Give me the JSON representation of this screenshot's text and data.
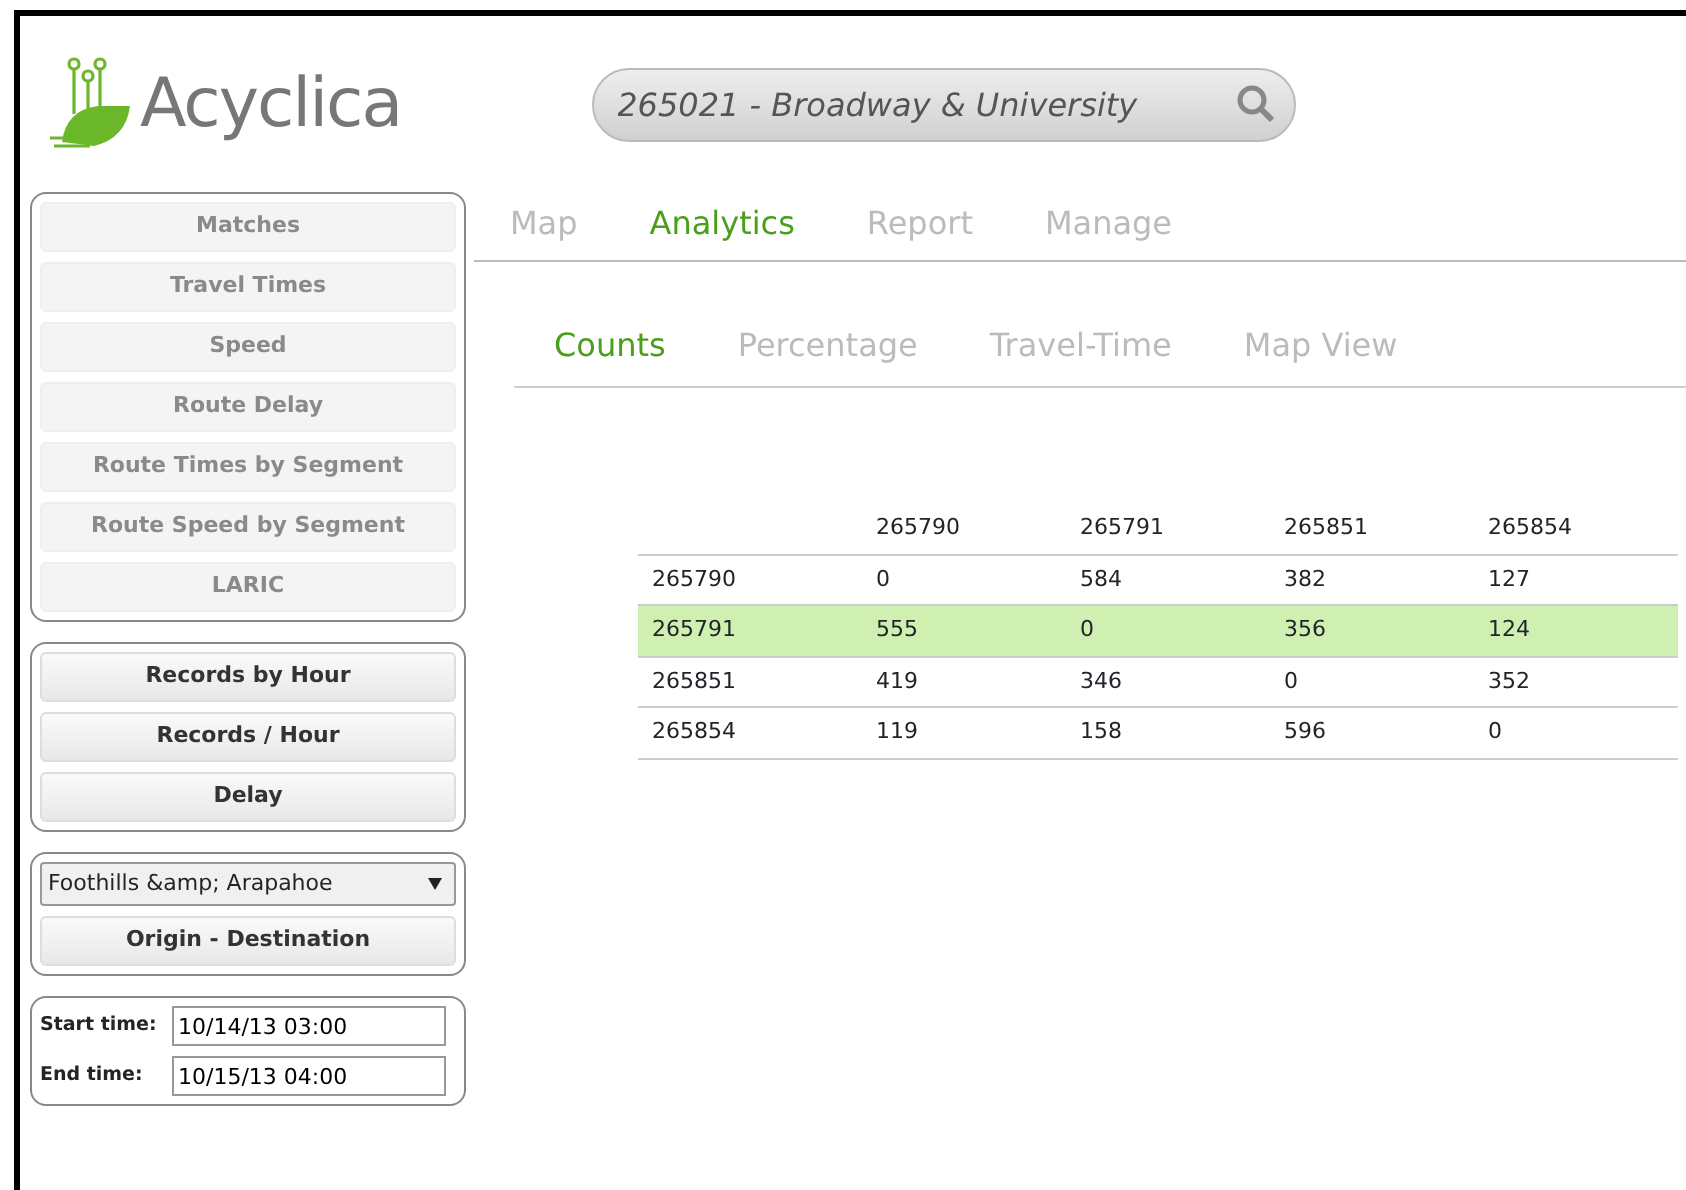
{
  "logo": {
    "text": "Acyclica"
  },
  "search": {
    "value": "265021 - Broadway & University"
  },
  "sidebar": {
    "groups": [
      {
        "kind": "buttons",
        "buttons": [
          {
            "label": "Matches",
            "disabled": true
          },
          {
            "label": "Travel Times",
            "disabled": true
          },
          {
            "label": "Speed",
            "disabled": true
          },
          {
            "label": "Route Delay",
            "disabled": true
          },
          {
            "label": "Route Times by Segment",
            "disabled": true
          },
          {
            "label": "Route Speed by Segment",
            "disabled": true
          },
          {
            "label": "LARIC",
            "disabled": true
          }
        ]
      },
      {
        "kind": "buttons",
        "buttons": [
          {
            "label": "Records by Hour",
            "disabled": false
          },
          {
            "label": "Records / Hour",
            "disabled": false
          },
          {
            "label": "Delay",
            "disabled": false
          }
        ]
      },
      {
        "kind": "select",
        "select": {
          "value": "Foothills &amp; Arapahoe"
        },
        "buttons": [
          {
            "label": "Origin - Destination",
            "disabled": false
          }
        ]
      },
      {
        "kind": "times",
        "fields": [
          {
            "label": "Start time:",
            "value": "10/14/13 03:00"
          },
          {
            "label": "End time:",
            "value": "10/15/13 04:00"
          }
        ]
      }
    ]
  },
  "tabs": [
    {
      "label": "Map",
      "selected": false
    },
    {
      "label": "Analytics",
      "selected": true
    },
    {
      "label": "Report",
      "selected": false
    },
    {
      "label": "Manage",
      "selected": false
    }
  ],
  "subtabs": [
    {
      "label": "Counts",
      "selected": true
    },
    {
      "label": "Percentage",
      "selected": false
    },
    {
      "label": "Travel-Time",
      "selected": false
    },
    {
      "label": "Map View",
      "selected": false
    }
  ],
  "table": {
    "columns": [
      "265790",
      "265791",
      "265851",
      "265854"
    ],
    "rows": [
      {
        "label": "265790",
        "cells": [
          "0",
          "584",
          "382",
          "127"
        ],
        "selected": false
      },
      {
        "label": "265791",
        "cells": [
          "555",
          "0",
          "356",
          "124"
        ],
        "selected": true
      },
      {
        "label": "265851",
        "cells": [
          "419",
          "346",
          "0",
          "352"
        ],
        "selected": false
      },
      {
        "label": "265854",
        "cells": [
          "119",
          "158",
          "596",
          "0"
        ],
        "selected": false
      }
    ]
  }
}
